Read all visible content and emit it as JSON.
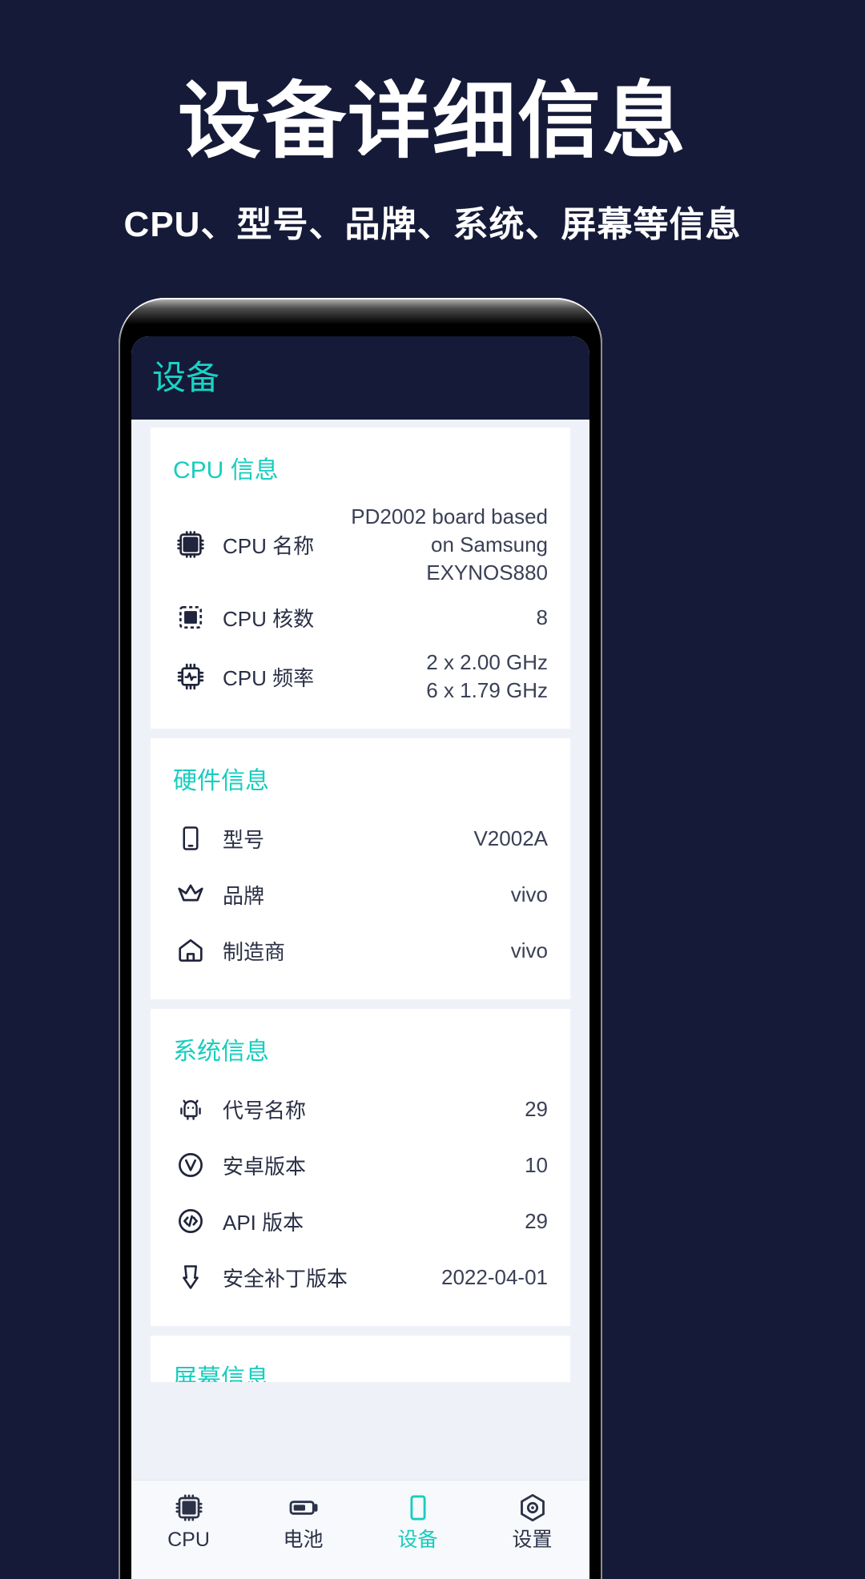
{
  "promo": {
    "title": "设备详细信息",
    "subtitle": "CPU、型号、品牌、系统、屏幕等信息",
    "bg_color": "#151a38",
    "text_color": "#ffffff"
  },
  "app": {
    "accent_color": "#17cdbe",
    "appbar_color": "#151a38",
    "title": "设备",
    "sections": [
      {
        "title": "CPU 信息",
        "rows": [
          {
            "icon": "cpu-chip-icon",
            "label": "CPU 名称",
            "value": [
              "PD2002 board based on Samsung",
              "EXYNOS880"
            ]
          },
          {
            "icon": "cpu-cores-icon",
            "label": "CPU 核数",
            "value": [
              "8"
            ]
          },
          {
            "icon": "cpu-frequency-icon",
            "label": "CPU 频率",
            "value": [
              "2 x 2.00 GHz",
              "6 x 1.79 GHz"
            ]
          }
        ]
      },
      {
        "title": "硬件信息",
        "rows": [
          {
            "icon": "phone-icon",
            "label": "型号",
            "value": [
              "V2002A"
            ]
          },
          {
            "icon": "crown-icon",
            "label": "品牌",
            "value": [
              "vivo"
            ]
          },
          {
            "icon": "home-icon",
            "label": "制造商",
            "value": [
              "vivo"
            ]
          }
        ]
      },
      {
        "title": "系统信息",
        "rows": [
          {
            "icon": "android-icon",
            "label": "代号名称",
            "value": [
              "29"
            ]
          },
          {
            "icon": "version-circle-icon",
            "label": "安卓版本",
            "value": [
              "10"
            ]
          },
          {
            "icon": "code-circle-icon",
            "label": "API 版本",
            "value": [
              "29"
            ]
          },
          {
            "icon": "patch-download-icon",
            "label": "安全补丁版本",
            "value": [
              "2022-04-01"
            ]
          }
        ]
      },
      {
        "title": "屏幕信息",
        "rows": []
      }
    ],
    "tabs": [
      {
        "icon": "cpu-chip-icon",
        "label": "CPU",
        "active": false
      },
      {
        "icon": "battery-icon",
        "label": "电池",
        "active": false
      },
      {
        "icon": "device-icon",
        "label": "设备",
        "active": true
      },
      {
        "icon": "settings-gear-icon",
        "label": "设置",
        "active": false
      }
    ]
  }
}
